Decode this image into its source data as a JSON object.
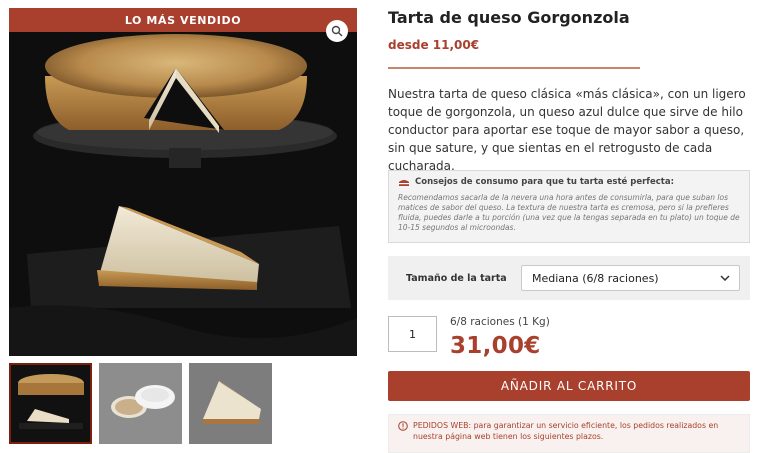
{
  "gallery": {
    "badge": "LO MÁS VENDIDO",
    "main_image": "cheesecake-whole-and-slice-photo",
    "thumbnails": [
      "cheesecake-on-dark-board",
      "cheesecake-in-round-box",
      "cheesecake-slice-closeup"
    ]
  },
  "product": {
    "title": "Tarta de queso Gorgonzola",
    "price_from": "desde 11,00€",
    "description": "Nuestra tarta de queso clásica «más clásica», con un ligero toque de gorgonzola, un queso azul dulce que sirve de hilo conductor para aportar ese toque de mayor sabor a queso, sin que sature, y que sientas en el retrogusto de cada cucharada."
  },
  "tips": {
    "title": "Consejos de consumo para que tu tarta esté perfecta:",
    "body": "Recomendamos sacarla de la nevera una hora antes de consumirla, para que suban los matices de sabor del queso. La textura de nuestra tarta es cremosa, pero si la prefieres fluida, puedes darle a tu porción (una vez que la tengas separada en tu plato) un toque de 10-15 segundos al microondas."
  },
  "size": {
    "label": "Tamaño de la tarta",
    "selected": "Mediana (6/8 raciones)"
  },
  "purchase": {
    "quantity": "1",
    "portion_text": "6/8 raciones (1 Kg)",
    "price": "31,00€",
    "add_to_cart": "AÑADIR AL CARRITO"
  },
  "notice": {
    "text": "PEDIDOS WEB: para garantizar un servicio eficiente, los pedidos realizados en nuestra página web tienen los siguientes plazos."
  },
  "colors": {
    "accent": "#a8402d",
    "divider": "#c8836f"
  }
}
